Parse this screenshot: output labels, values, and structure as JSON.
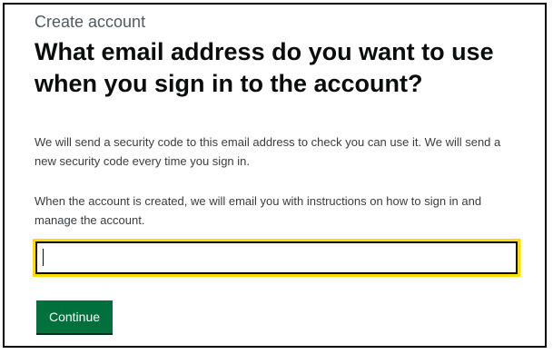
{
  "form": {
    "caption": "Create account",
    "heading": "What email address do you want to use when you sign in to the account?",
    "paragraphs": [
      "We will send a security code to this email address to check you can use it. We will send a new security code every time you sign in.",
      "When the account is created, we will email you with instructions on how to sign in and manage the account."
    ],
    "email": {
      "value": "",
      "placeholder": ""
    },
    "continue_label": "Continue"
  },
  "colors": {
    "button": "#00703c",
    "focus": "#ffdd00",
    "text": "#0b0c0c",
    "secondary_text": "#505a5f"
  }
}
